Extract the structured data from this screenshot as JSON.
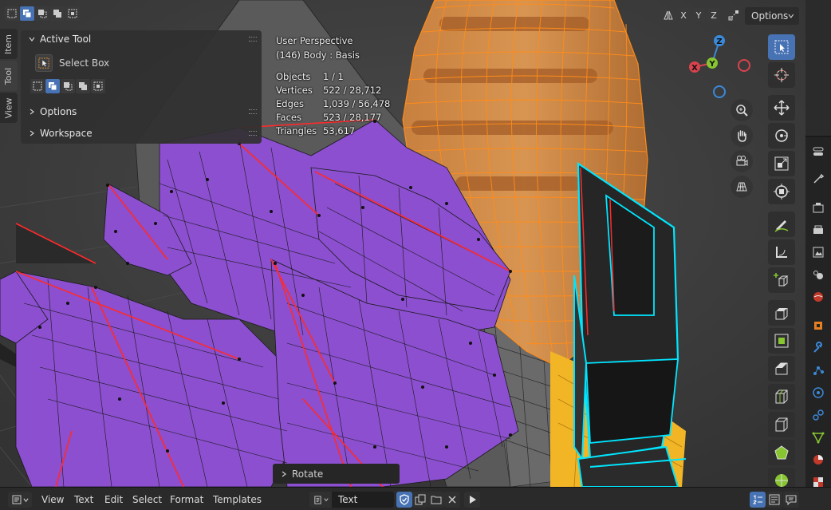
{
  "viewport": {
    "perspective_label": "User Perspective",
    "object_label": "(146) Body : Basis",
    "stats": [
      {
        "key": "Objects",
        "value": "1 / 1"
      },
      {
        "key": "Vertices",
        "value": "522 / 28,712"
      },
      {
        "key": "Edges",
        "value": "1,039 / 56,478"
      },
      {
        "key": "Faces",
        "value": "523 / 28,177"
      },
      {
        "key": "Triangles",
        "value": "53,617"
      }
    ]
  },
  "sidebar_tabs": [
    "Item",
    "Tool",
    "View"
  ],
  "tool_panel": {
    "active_tool_title": "Active Tool",
    "tool_name": "Select Box",
    "options_title": "Options",
    "workspace_title": "Workspace"
  },
  "header_right": {
    "axis_x": "X",
    "axis_y": "Y",
    "axis_z": "Z",
    "options_label": "Options"
  },
  "gizmo": {
    "x": "X",
    "y": "Y",
    "z": "Z"
  },
  "redo_panel": {
    "label": "Rotate"
  },
  "bottom_bar": {
    "menu": [
      "View",
      "Text",
      "Edit",
      "Select",
      "Format",
      "Templates"
    ],
    "text_block_name": "Text"
  },
  "colors": {
    "accent": "#4772b3",
    "selected_face": "#8b4fcf",
    "seam": "#ff2a2a",
    "sharp_edge": "#00e5ff",
    "orange_wire": "#ff8c1a",
    "yellow": "#f2b526",
    "gizmo_x": "#d9434e",
    "gizmo_y": "#87c531",
    "gizmo_z": "#3b89d9"
  },
  "icons": {
    "tool": "select-box-icon",
    "nav": [
      "zoom-icon",
      "hand-pan-icon",
      "camera-icon",
      "grid-view-icon"
    ]
  }
}
